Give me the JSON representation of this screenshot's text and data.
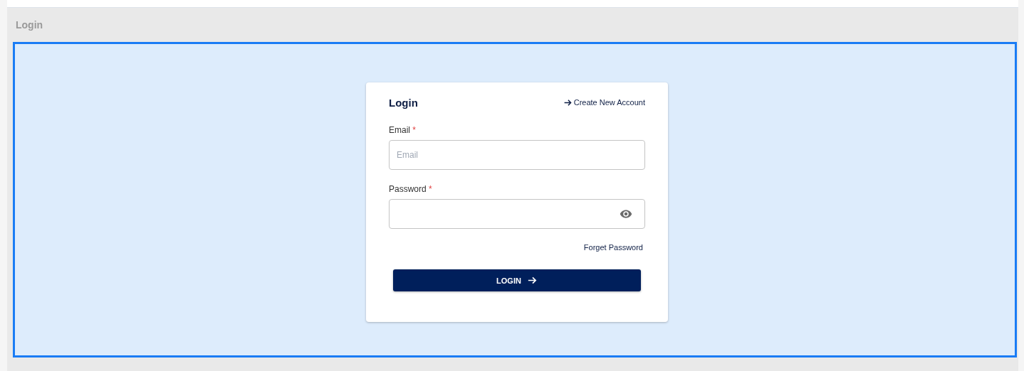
{
  "panel": {
    "title": "Login"
  },
  "card": {
    "title": "Login",
    "create_link": "Create New Account",
    "fields": [
      {
        "kind": "text",
        "label": "Email",
        "required_mark": "*",
        "placeholder": "Email"
      },
      {
        "kind": "password",
        "label": "Password",
        "required_mark": "*"
      }
    ],
    "forgot_link": "Forget Password",
    "submit": "LOGIN"
  }
}
